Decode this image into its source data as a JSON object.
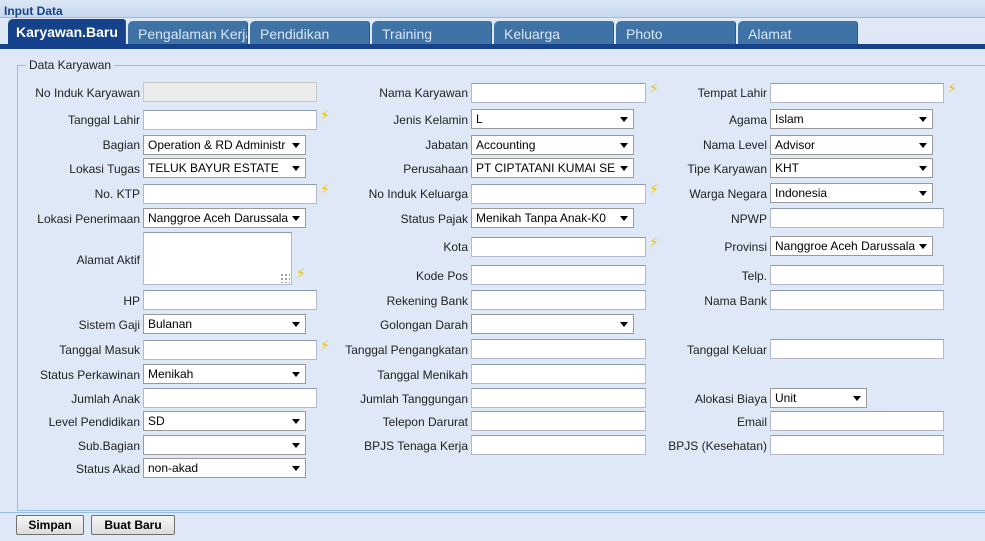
{
  "panel": {
    "title": "Input Data"
  },
  "tabs": [
    {
      "label": "Karyawan.Baru"
    },
    {
      "label": "Pengalaman Kerja"
    },
    {
      "label": "Pendidikan"
    },
    {
      "label": "Training"
    },
    {
      "label": "Keluarga"
    },
    {
      "label": "Photo"
    },
    {
      "label": "Alamat"
    }
  ],
  "fieldset": {
    "legend": "Data Karyawan"
  },
  "col1": {
    "no_induk": {
      "label": "No Induk Karyawan",
      "value": ""
    },
    "tanggal_lahir": {
      "label": "Tanggal Lahir",
      "value": ""
    },
    "bagian": {
      "label": "Bagian",
      "value": "Operation & RD Administr"
    },
    "lokasi_tugas": {
      "label": "Lokasi Tugas",
      "value": "TELUK BAYUR ESTATE"
    },
    "no_ktp": {
      "label": "No. KTP",
      "value": ""
    },
    "lokasi_penerimaan": {
      "label": "Lokasi Penerimaan",
      "value": "Nanggroe Aceh Darussala"
    },
    "alamat_aktif": {
      "label": "Alamat Aktif",
      "value": ""
    },
    "hp": {
      "label": "HP",
      "value": ""
    },
    "sistem_gaji": {
      "label": "Sistem Gaji",
      "value": "Bulanan"
    },
    "tanggal_masuk": {
      "label": "Tanggal Masuk",
      "value": ""
    },
    "status_perkawinan": {
      "label": "Status Perkawinan",
      "value": "Menikah"
    },
    "jumlah_anak": {
      "label": "Jumlah Anak",
      "value": ""
    },
    "level_pendidikan": {
      "label": "Level Pendidikan",
      "value": "SD"
    },
    "sub_bagian": {
      "label": "Sub.Bagian",
      "value": ""
    },
    "status_akad": {
      "label": "Status Akad",
      "value": "non-akad"
    }
  },
  "col2": {
    "nama_karyawan": {
      "label": "Nama Karyawan",
      "value": ""
    },
    "jenis_kelamin": {
      "label": "Jenis Kelamin",
      "value": "L"
    },
    "jabatan": {
      "label": "Jabatan",
      "value": "Accounting"
    },
    "perusahaan": {
      "label": "Perusahaan",
      "value": "PT CIPTATANI KUMAI SE"
    },
    "no_induk_keluarga": {
      "label": "No Induk Keluarga",
      "value": ""
    },
    "status_pajak": {
      "label": "Status Pajak",
      "value": "Menikah Tanpa Anak-K0"
    },
    "kota": {
      "label": "Kota",
      "value": ""
    },
    "kode_pos": {
      "label": "Kode Pos",
      "value": ""
    },
    "rekening_bank": {
      "label": "Rekening Bank",
      "value": ""
    },
    "golongan_darah": {
      "label": "Golongan Darah",
      "value": ""
    },
    "tanggal_pengangkatan": {
      "label": "Tanggal Pengangkatan",
      "value": ""
    },
    "tanggal_menikah": {
      "label": "Tanggal Menikah",
      "value": ""
    },
    "jumlah_tanggungan": {
      "label": "Jumlah Tanggungan",
      "value": ""
    },
    "telepon_darurat": {
      "label": "Telepon Darurat",
      "value": ""
    },
    "bpjs_tenaga_kerja": {
      "label": "BPJS Tenaga Kerja",
      "value": ""
    }
  },
  "col3": {
    "tempat_lahir": {
      "label": "Tempat Lahir",
      "value": ""
    },
    "agama": {
      "label": "Agama",
      "value": "Islam"
    },
    "nama_level": {
      "label": "Nama Level",
      "value": "Advisor"
    },
    "tipe_karyawan": {
      "label": "Tipe Karyawan",
      "value": "KHT"
    },
    "warga_negara": {
      "label": "Warga Negara",
      "value": "Indonesia"
    },
    "npwp": {
      "label": "NPWP",
      "value": ""
    },
    "provinsi": {
      "label": "Provinsi",
      "value": "Nanggroe Aceh Darussala"
    },
    "telp": {
      "label": "Telp.",
      "value": ""
    },
    "nama_bank": {
      "label": "Nama Bank",
      "value": ""
    },
    "tanggal_keluar": {
      "label": "Tanggal Keluar",
      "value": ""
    },
    "alokasi_biaya": {
      "label": "Alokasi Biaya",
      "value": "Unit"
    },
    "email": {
      "label": "Email",
      "value": ""
    },
    "bpjs_kesehatan": {
      "label": "BPJS (Kesehatan)",
      "value": ""
    }
  },
  "buttons": {
    "simpan": "Simpan",
    "buat_baru": "Buat Baru"
  },
  "icons": {
    "required": "lightning-bolt-icon"
  },
  "colors": {
    "tab_active": "#15428b",
    "tab_inactive": "#3f73a6",
    "background": "#dfe8f6",
    "required_icon": "#f2c200"
  }
}
